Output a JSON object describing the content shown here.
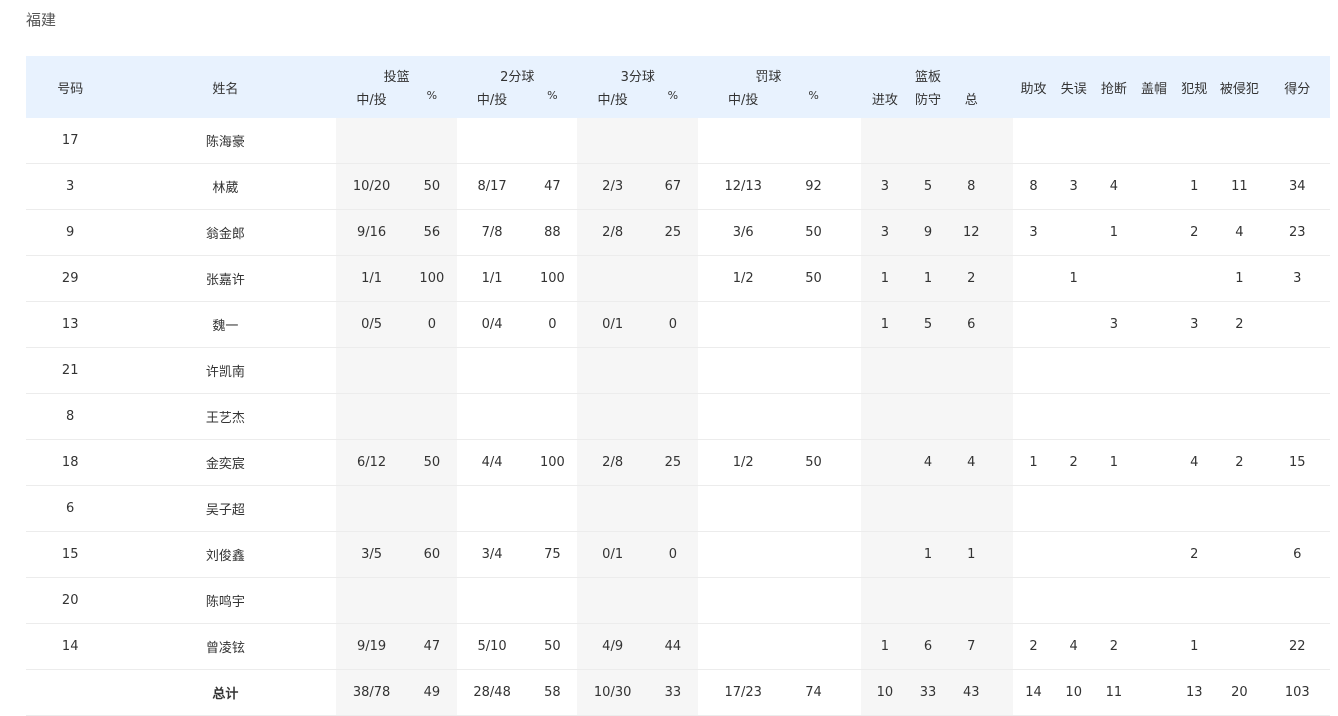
{
  "team": "福建",
  "header": {
    "number": "号码",
    "name": "姓名",
    "groups": {
      "fg": "投篮",
      "two": "2分球",
      "three": "3分球",
      "ft": "罚球",
      "reb": "篮板"
    },
    "made_att": "中/投",
    "pct": "%",
    "reb_off": "进攻",
    "reb_def": "防守",
    "reb_tot": "总",
    "ast": "助攻",
    "tov": "失误",
    "stl": "抢断",
    "blk": "盖帽",
    "pf": "犯规",
    "fd": "被侵犯",
    "pts": "得分"
  },
  "rows": [
    {
      "num": "17",
      "name": "陈海豪",
      "fg": "",
      "fg_pct": "",
      "two": "",
      "two_pct": "",
      "three": "",
      "three_pct": "",
      "ft": "",
      "ft_pct": "",
      "oreb": "",
      "dreb": "",
      "treb": "",
      "ast": "",
      "tov": "",
      "stl": "",
      "blk": "",
      "pf": "",
      "fd": "",
      "pts": ""
    },
    {
      "num": "3",
      "name": "林葳",
      "fg": "10/20",
      "fg_pct": "50",
      "two": "8/17",
      "two_pct": "47",
      "three": "2/3",
      "three_pct": "67",
      "ft": "12/13",
      "ft_pct": "92",
      "oreb": "3",
      "dreb": "5",
      "treb": "8",
      "ast": "8",
      "tov": "3",
      "stl": "4",
      "blk": "",
      "pf": "1",
      "fd": "11",
      "pts": "34"
    },
    {
      "num": "9",
      "name": "翁金郎",
      "fg": "9/16",
      "fg_pct": "56",
      "two": "7/8",
      "two_pct": "88",
      "three": "2/8",
      "three_pct": "25",
      "ft": "3/6",
      "ft_pct": "50",
      "oreb": "3",
      "dreb": "9",
      "treb": "12",
      "ast": "3",
      "tov": "",
      "stl": "1",
      "blk": "",
      "pf": "2",
      "fd": "4",
      "pts": "23"
    },
    {
      "num": "29",
      "name": "张嘉许",
      "fg": "1/1",
      "fg_pct": "100",
      "two": "1/1",
      "two_pct": "100",
      "three": "",
      "three_pct": "",
      "ft": "1/2",
      "ft_pct": "50",
      "oreb": "1",
      "dreb": "1",
      "treb": "2",
      "ast": "",
      "tov": "1",
      "stl": "",
      "blk": "",
      "pf": "",
      "fd": "1",
      "pts": "3"
    },
    {
      "num": "13",
      "name": "魏一",
      "fg": "0/5",
      "fg_pct": "0",
      "two": "0/4",
      "two_pct": "0",
      "three": "0/1",
      "three_pct": "0",
      "ft": "",
      "ft_pct": "",
      "oreb": "1",
      "dreb": "5",
      "treb": "6",
      "ast": "",
      "tov": "",
      "stl": "3",
      "blk": "",
      "pf": "3",
      "fd": "2",
      "pts": ""
    },
    {
      "num": "21",
      "name": "许凯南",
      "fg": "",
      "fg_pct": "",
      "two": "",
      "two_pct": "",
      "three": "",
      "three_pct": "",
      "ft": "",
      "ft_pct": "",
      "oreb": "",
      "dreb": "",
      "treb": "",
      "ast": "",
      "tov": "",
      "stl": "",
      "blk": "",
      "pf": "",
      "fd": "",
      "pts": ""
    },
    {
      "num": "8",
      "name": "王艺杰",
      "fg": "",
      "fg_pct": "",
      "two": "",
      "two_pct": "",
      "three": "",
      "three_pct": "",
      "ft": "",
      "ft_pct": "",
      "oreb": "",
      "dreb": "",
      "treb": "",
      "ast": "",
      "tov": "",
      "stl": "",
      "blk": "",
      "pf": "",
      "fd": "",
      "pts": ""
    },
    {
      "num": "18",
      "name": "金奕宸",
      "fg": "6/12",
      "fg_pct": "50",
      "two": "4/4",
      "two_pct": "100",
      "three": "2/8",
      "three_pct": "25",
      "ft": "1/2",
      "ft_pct": "50",
      "oreb": "",
      "dreb": "4",
      "treb": "4",
      "ast": "1",
      "tov": "2",
      "stl": "1",
      "blk": "",
      "pf": "4",
      "fd": "2",
      "pts": "15"
    },
    {
      "num": "6",
      "name": "吴子超",
      "fg": "",
      "fg_pct": "",
      "two": "",
      "two_pct": "",
      "three": "",
      "three_pct": "",
      "ft": "",
      "ft_pct": "",
      "oreb": "",
      "dreb": "",
      "treb": "",
      "ast": "",
      "tov": "",
      "stl": "",
      "blk": "",
      "pf": "",
      "fd": "",
      "pts": ""
    },
    {
      "num": "15",
      "name": "刘俊鑫",
      "fg": "3/5",
      "fg_pct": "60",
      "two": "3/4",
      "two_pct": "75",
      "three": "0/1",
      "three_pct": "0",
      "ft": "",
      "ft_pct": "",
      "oreb": "",
      "dreb": "1",
      "treb": "1",
      "ast": "",
      "tov": "",
      "stl": "",
      "blk": "",
      "pf": "2",
      "fd": "",
      "pts": "6"
    },
    {
      "num": "20",
      "name": "陈鸣宇",
      "fg": "",
      "fg_pct": "",
      "two": "",
      "two_pct": "",
      "three": "",
      "three_pct": "",
      "ft": "",
      "ft_pct": "",
      "oreb": "",
      "dreb": "",
      "treb": "",
      "ast": "",
      "tov": "",
      "stl": "",
      "blk": "",
      "pf": "",
      "fd": "",
      "pts": ""
    },
    {
      "num": "14",
      "name": "曾凌铉",
      "fg": "9/19",
      "fg_pct": "47",
      "two": "5/10",
      "two_pct": "50",
      "three": "4/9",
      "three_pct": "44",
      "ft": "",
      "ft_pct": "",
      "oreb": "1",
      "dreb": "6",
      "treb": "7",
      "ast": "2",
      "tov": "4",
      "stl": "2",
      "blk": "",
      "pf": "1",
      "fd": "",
      "pts": "22"
    }
  ],
  "total": {
    "num": "",
    "name": "总计",
    "fg": "38/78",
    "fg_pct": "49",
    "two": "28/48",
    "two_pct": "58",
    "three": "10/30",
    "three_pct": "33",
    "ft": "17/23",
    "ft_pct": "74",
    "oreb": "10",
    "dreb": "33",
    "treb": "43",
    "ast": "14",
    "tov": "10",
    "stl": "11",
    "blk": "",
    "pf": "13",
    "fd": "20",
    "pts": "103"
  }
}
